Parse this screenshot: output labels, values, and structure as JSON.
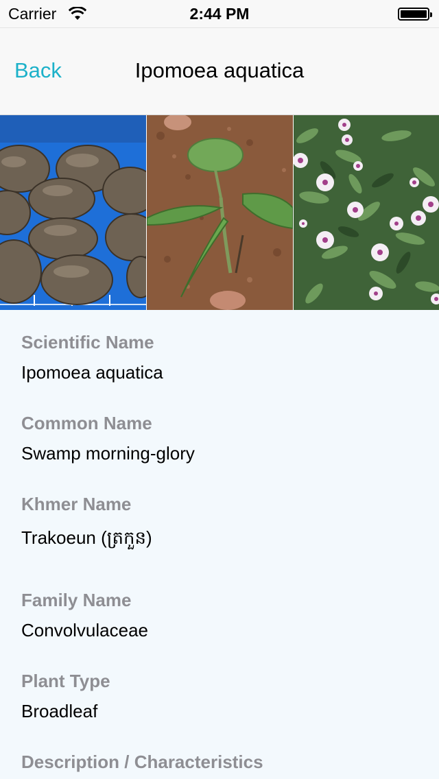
{
  "status_bar": {
    "carrier": "Carrier",
    "time": "2:44 PM",
    "battery_level": 1.0
  },
  "nav": {
    "back_label": "Back",
    "title": "Ipomoea aquatica"
  },
  "gallery": {
    "photos": [
      {
        "subject": "seeds"
      },
      {
        "subject": "seedling"
      },
      {
        "subject": "flowering plants"
      }
    ]
  },
  "details": {
    "scientific": {
      "label": "Scientific Name",
      "value": "Ipomoea aquatica"
    },
    "common": {
      "label": "Common Name",
      "value": "Swamp morning-glory"
    },
    "khmer": {
      "label": "Khmer Name",
      "value": "Trakoeun (ត្រកួន)"
    },
    "family": {
      "label": "Family Name",
      "value": "Convolvulaceae"
    },
    "plant_type": {
      "label": "Plant Type",
      "value": "Broadleaf"
    },
    "description": {
      "label": "Description / Characteristics"
    }
  },
  "colors": {
    "accent": "#1cb1c9",
    "label_gray": "#8e8e93",
    "content_bg": "#f3f9fd"
  }
}
